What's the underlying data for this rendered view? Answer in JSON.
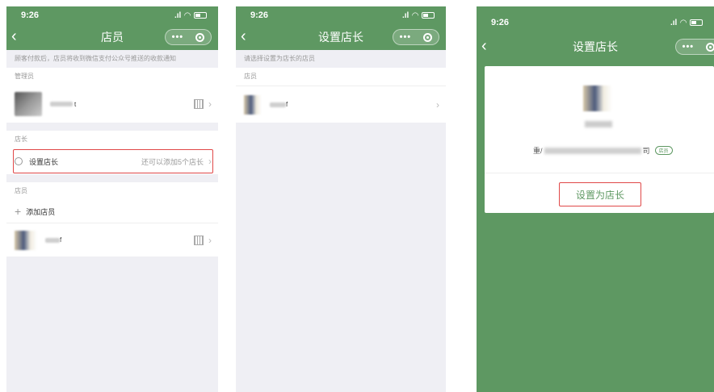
{
  "status_time": "9:26",
  "screen1": {
    "title": "店员",
    "hint": "顾客付款后，店员将收到微信支付公众号推送的收款通知",
    "admin_section": "管理员",
    "admin_name": "t",
    "manager_section": "店长",
    "set_manager_label": "设置店长",
    "set_manager_note": "还可以添加5个店长",
    "staff_section": "店员",
    "add_staff_label": "添加店员",
    "staff_name": "f"
  },
  "screen2": {
    "title": "设置店长",
    "hint": "请选择设置为店长的店员",
    "staff_section": "店员",
    "staff_name": "f"
  },
  "screen3": {
    "title": "设置店长",
    "company_prefix": "重/",
    "company_suffix": "司",
    "role_tag": "店员",
    "set_button": "设置为店长"
  },
  "colors": {
    "brand": "#5e9862",
    "highlight": "#e04848"
  }
}
